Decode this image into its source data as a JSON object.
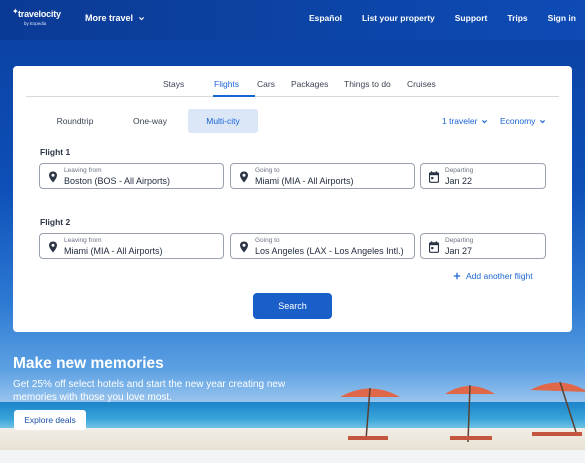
{
  "header": {
    "logo_text": "travelocity",
    "logo_sub": "by Expedia",
    "more_travel": "More travel",
    "links": [
      "Español",
      "List your property",
      "Support",
      "Trips",
      "Sign in"
    ]
  },
  "tabs": [
    {
      "label": "Stays",
      "active": false
    },
    {
      "label": "Flights",
      "active": true
    },
    {
      "label": "Cars",
      "active": false
    },
    {
      "label": "Packages",
      "active": false
    },
    {
      "label": "Things to do",
      "active": false
    },
    {
      "label": "Cruises",
      "active": false
    }
  ],
  "trip_types": [
    {
      "label": "Roundtrip",
      "active": false
    },
    {
      "label": "One-way",
      "active": false
    },
    {
      "label": "Multi-city",
      "active": true
    }
  ],
  "travelers": "1 traveler",
  "cabin_class": "Economy",
  "flights": [
    {
      "label": "Flight 1",
      "leaving_label": "Leaving from",
      "leaving_value": "Boston (BOS - All Airports)",
      "going_label": "Going to",
      "going_value": "Miami (MIA - All Airports)",
      "departing_label": "Departing",
      "departing_value": "Jan 22"
    },
    {
      "label": "Flight 2",
      "leaving_label": "Leaving from",
      "leaving_value": "Miami (MIA - All Airports)",
      "going_label": "Going to",
      "going_value": "Los Angeles (LAX - Los Angeles Intl.)",
      "departing_label": "Departing",
      "departing_value": "Jan 27"
    }
  ],
  "add_flight": "Add another flight",
  "search_button": "Search",
  "promo": {
    "title": "Make new memories",
    "text": "Get 25% off select hotels and start the new year creating new memories with those you love most.",
    "button": "Explore deals"
  },
  "colors": {
    "brand_blue": "#0b3a94",
    "accent": "#1a64d6",
    "button": "#1a5ec8"
  }
}
